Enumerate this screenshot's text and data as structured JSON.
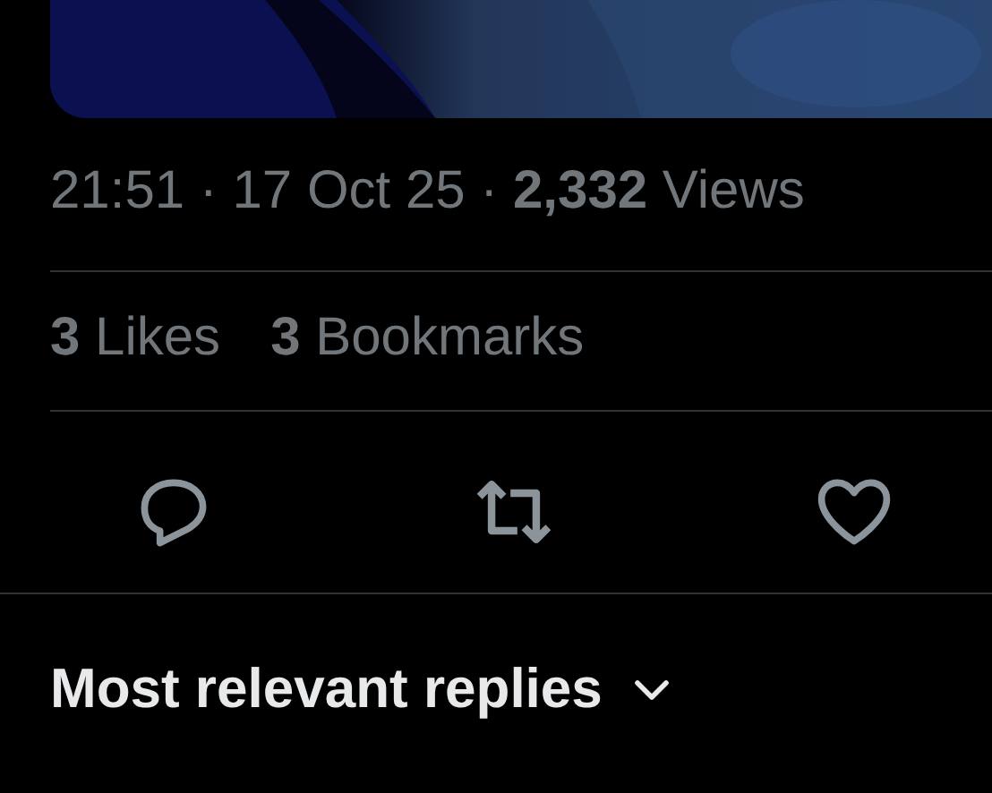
{
  "media": {
    "kind": "picture"
  },
  "meta": "21:51 · 17 Oct 25 · **2,332** Views",
  "stats": [
    "**3** Likes",
    "**3** Bookmarks"
  ],
  "actions": [
    {
      "kind": "reply"
    },
    {
      "kind": "repost"
    },
    {
      "kind": "like"
    }
  ],
  "replies_sort": {
    "label": "Most relevant replies"
  }
}
